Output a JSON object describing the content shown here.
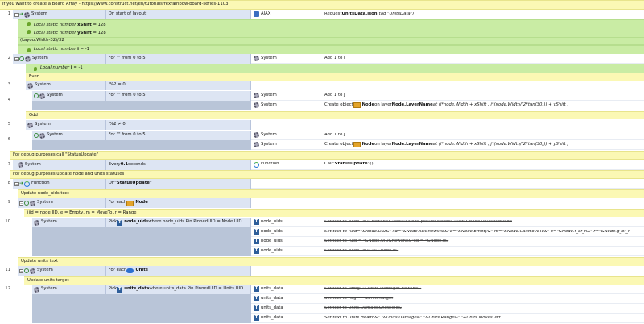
{
  "comments": {
    "c1": "If you want to create a Board Array - https://www.construct.net/en/tutorials/rexrainbow-board-series-1103",
    "c2": "(LayoutWidth-32)/32",
    "c3": "For debug purposes call \"StatusUpdate\"",
    "c4": "For debug purposes update node and units statuses"
  },
  "groups": {
    "even": "Even",
    "odd": "Odd",
    "update_node_uids": "Update node_uids text",
    "legend": "iiid = node IID, e = Empty, m = MoveTo, r = Range",
    "update_units_text": "Update units text",
    "update_units_target": "Update units target"
  },
  "vars": {
    "xshift": {
      "label": "Local static number",
      "name": "xShift",
      "value": "= 128"
    },
    "yshift": {
      "label": "Local static number",
      "name": "yShift",
      "value": "= 128"
    },
    "i": {
      "label": "Local static number",
      "name": "i",
      "value": "= -1"
    },
    "j": {
      "label": "Local number",
      "name": "j",
      "value": "= -1"
    }
  },
  "events": {
    "e1": {
      "num": "1",
      "obj": "System",
      "cond": "On start of layout",
      "act_obj": "AJAX",
      "act_pre": "Request ",
      "act_bold": "UnitsData.json",
      "act_post": " (tag \"UnitsData\")"
    },
    "e2": {
      "num": "2",
      "obj": "System",
      "cond": "For \"\" from 0 to 5",
      "act_obj": "System",
      "act": "Add 1 to i"
    },
    "e3": {
      "num": "3",
      "obj": "System",
      "cond": "i%2 = 0"
    },
    "e4": {
      "num": "4",
      "obj": "System",
      "cond": "For \"\" from 0 to 5",
      "act1_obj": "System",
      "act1": "Add 1 to j",
      "act2_obj": "System",
      "act2_pre": "Create object ",
      "act2_node": "Node",
      "act2_mid": " on layer ",
      "act2_layer": "Node.LayerName",
      "act2_post": " at (i*node.Width + xShift , j*(node.Width/(2*tan(30))) + yShift  )"
    },
    "e5": {
      "num": "5",
      "obj": "System",
      "cond": "i%2 ≠ 0"
    },
    "e6": {
      "num": "6",
      "obj": "System",
      "cond": "For \"\" from 0 to 5",
      "act1_obj": "System",
      "act1": "Add 1 to j",
      "act2_obj": "System",
      "act2_pre": "Create object ",
      "act2_node": "Node",
      "act2_mid": " on layer ",
      "act2_layer": "Node.LayerName",
      "act2_post": " at (i*node.Width + xShift , j*(node.Width/(2*tan(30))) + yShift  )"
    },
    "e7": {
      "num": "7",
      "obj": "System",
      "cond_pre": "Every ",
      "cond_bold": "0.1",
      "cond_post": " seconds",
      "act_obj": "Function",
      "act_pre": "Call ",
      "act_bold": "\"StatusUpdate\"",
      "act_post": " ()"
    },
    "e8": {
      "num": "8",
      "obj": "Function",
      "cond_pre": "On ",
      "cond_bold": "\"StatusUpdate\""
    },
    "e9": {
      "num": "9",
      "obj": "System",
      "cond": "For each ",
      "cond_bold": "Node"
    },
    "e10": {
      "num": "10",
      "obj": "System",
      "cond_pre": "Pick ",
      "cond_bold": "node_uids",
      "cond_post": " where node_uids.Pin.PinnedUID = Node.UID",
      "actions": [
        {
          "obj": "node_uids",
          "text": "Set text to Node.UID&newline&\"prev\"&Node.prevlbnewline&\"vist\"&Node.unvisitedNode"
        },
        {
          "obj": "node_uids",
          "text": "Set text to \"uid=\"&Node.UID&\" iid=\"&Node.IID&newline&\"e=\"&Node.Empty&\"  m=\"&Node.CanMoveTo&\" c=\"&Node.f_of_n&\"  r=\"&Node.g_of_n"
        },
        {
          "obj": "node_uids",
          "text": "Set text to \"uid = \"&Node.UID&newline&\"iid = \"&Node.IID"
        },
        {
          "obj": "node_uids",
          "text": "Set text to Node.UID&\"/\"&Node.IID"
        }
      ]
    },
    "e11": {
      "num": "11",
      "obj": "System",
      "cond": "For each ",
      "cond_bold": "Units"
    },
    "e12": {
      "num": "12",
      "obj": "System",
      "cond_pre": "Pick ",
      "cond_bold": "units_data",
      "cond_post": " where units_data.Pin.PinnedUID = Units.UID",
      "actions": [
        {
          "obj": "units_data",
          "text": "Set text to \"dmg: \"&Units.Damage&newline&",
          "strike": true
        },
        {
          "obj": "units_data",
          "text": "Set text to \"trg = \"&Units.target",
          "strike": true
        },
        {
          "obj": "units_data",
          "text": "Set text to Units.Damage&newline&",
          "strike": true
        },
        {
          "obj": "units_data",
          "text": "Set text to Units.Health&\"     \"&Units.Damage&\"     \"&Units.Range&\"    \"&Units.MovesLeft",
          "strike": false
        }
      ]
    }
  }
}
